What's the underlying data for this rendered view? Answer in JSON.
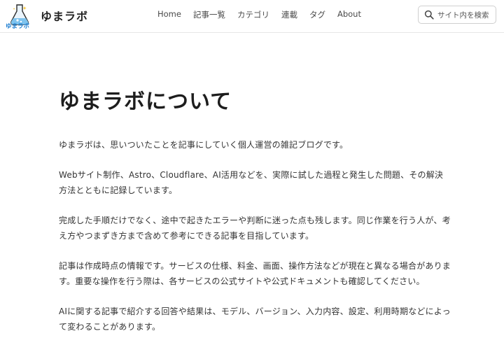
{
  "header": {
    "logo_alt": "ゆまラボ",
    "logo_text": "ゆまラボ",
    "site_title": "ゆまラボ",
    "nav": [
      {
        "label": "Home"
      },
      {
        "label": "記事一覧"
      },
      {
        "label": "カテゴリ"
      },
      {
        "label": "連載"
      },
      {
        "label": "タグ"
      },
      {
        "label": "About"
      }
    ],
    "search": {
      "placeholder": "サイト内を検索",
      "icon": "search-icon"
    }
  },
  "main": {
    "title": "ゆまラボについて",
    "paragraphs": [
      "ゆまラボは、思いついたことを記事にしていく個人運営の雑記ブログです。",
      "Webサイト制作、Astro、Cloudflare、AI活用などを、実際に試した過程と発生した問題、その解決方法とともに記録しています。",
      "完成した手順だけでなく、途中で起きたエラーや判断に迷った点も残します。同じ作業を行う人が、考え方やつまずき方まで含めて参考にできる記事を目指しています。",
      "記事は作成時点の情報です。サービスの仕様、料金、画面、操作方法などが現在と異なる場合があります。重要な操作を行う際は、各サービスの公式サイトや公式ドキュメントも確認してください。",
      "AIに関する記事で紹介する回答や結果は、モデル、バージョン、入力内容、設定、利用時期などによって変わることがあります。"
    ]
  },
  "colors": {
    "logo_blue": "#1f7fd1",
    "logo_yellow": "#f2c230",
    "text": "#333333",
    "border": "#e6e6e6"
  }
}
